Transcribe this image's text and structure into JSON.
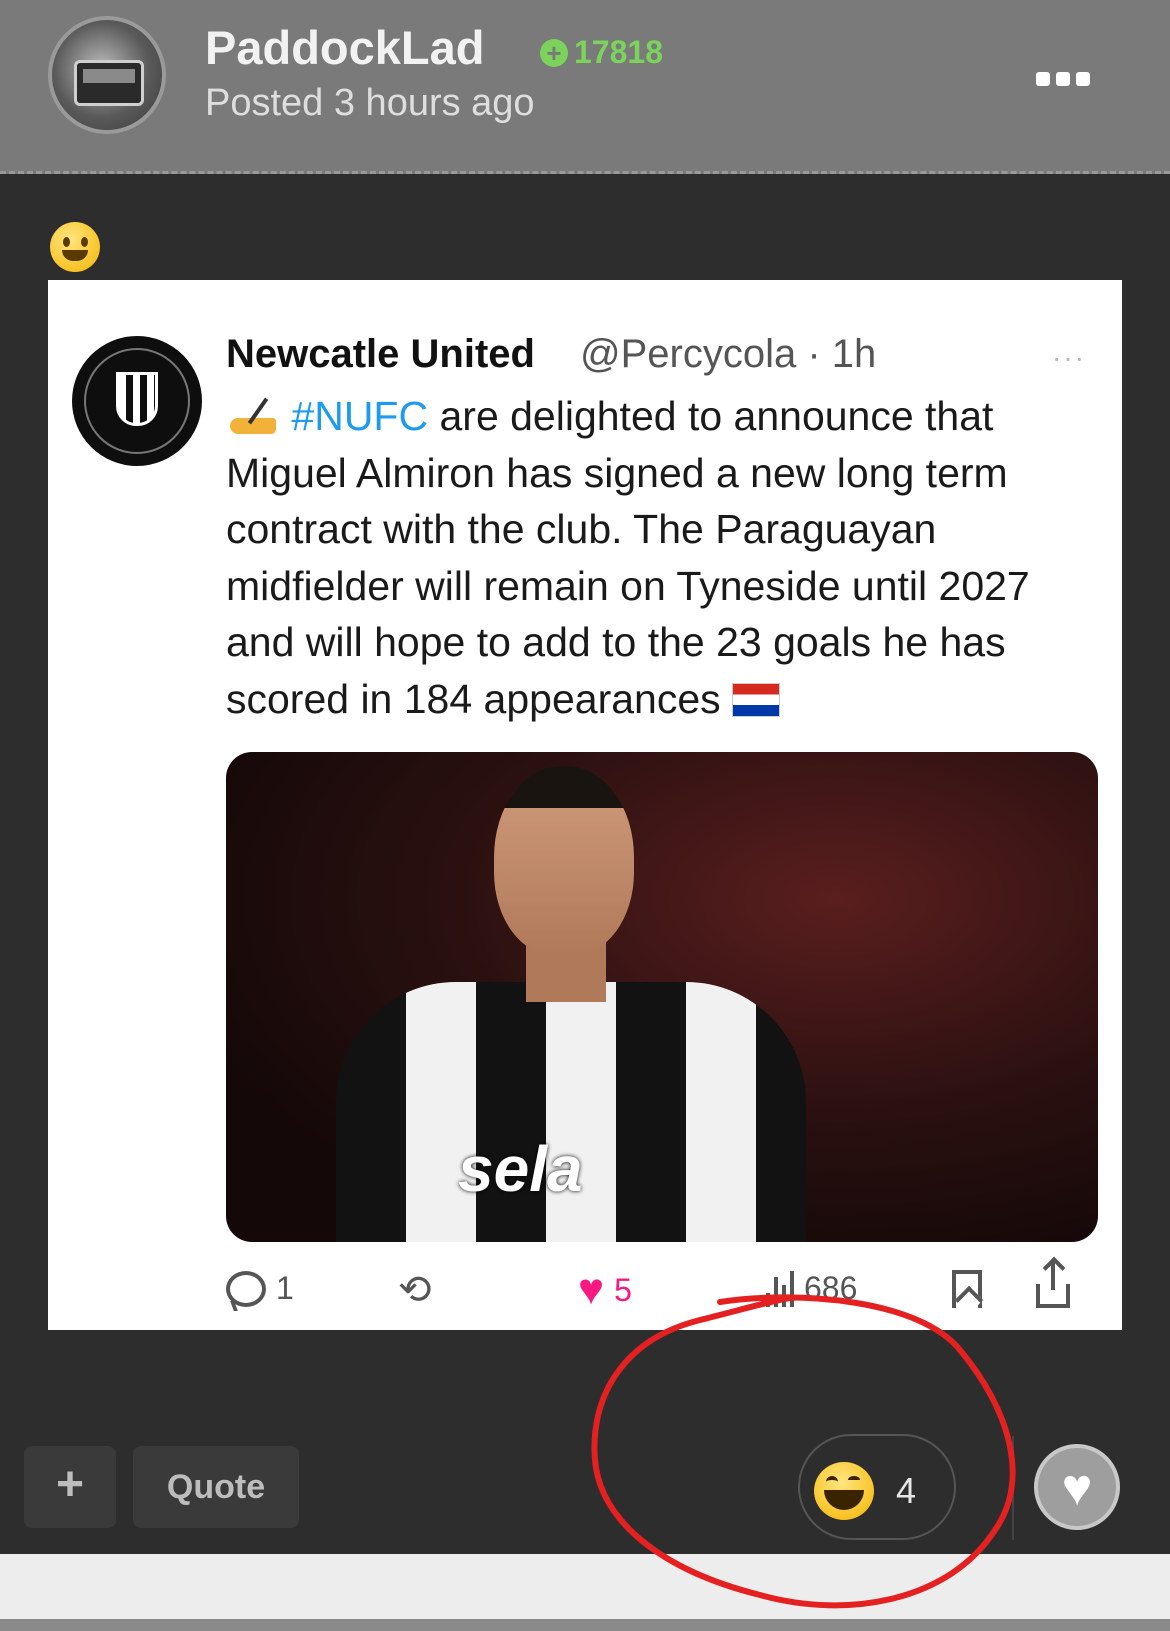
{
  "post": {
    "username": "PaddockLad",
    "reputation": "17818",
    "posted": "Posted 3 hours ago",
    "menu_icon": "more-options-icon"
  },
  "tweet": {
    "name": "Newcatle United",
    "handle": "@Percycola · 1h",
    "more": "···",
    "hashtag": "#NUFC",
    "text_1": " are delighted to announce that Miguel Almiron has signed a new long term contract with the club. The Paraguayan midfielder will remain on Tyneside until 2027 and will hope to add to the 23 goals he has scored in 184 appearances ",
    "photo_sponsor": "sela",
    "actions": {
      "replies": "1",
      "likes": "5",
      "views": "686"
    }
  },
  "footer": {
    "plus_label": "+",
    "quote_label": "Quote",
    "reaction_count": "4",
    "like_icon": "♥"
  },
  "colors": {
    "header_bg": "#7a7a7a",
    "reputation_green": "#7cd35c",
    "hashtag_blue": "#1d9bf0",
    "like_pink": "#f91880",
    "annotation_red": "#e52020"
  }
}
